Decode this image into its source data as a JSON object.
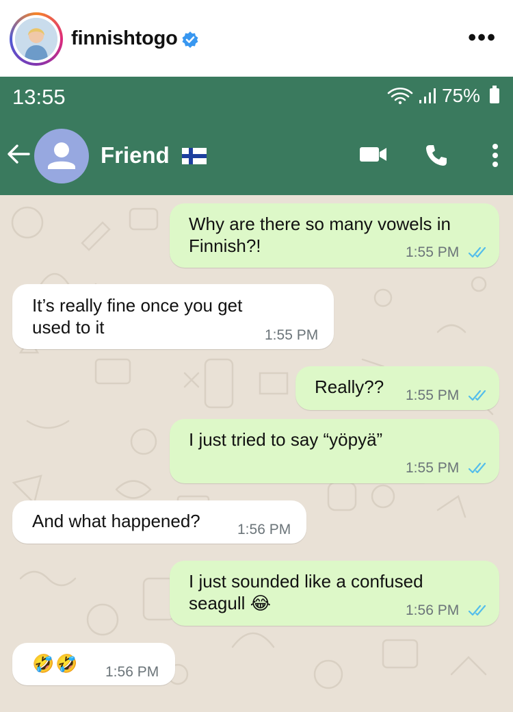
{
  "instagram": {
    "username": "finnishtogo",
    "more": "•••"
  },
  "status_bar": {
    "time": "13:55",
    "battery": "75%"
  },
  "chat_header": {
    "contact_name": "Friend"
  },
  "messages": [
    {
      "direction": "outgoing",
      "text": "Why are there so many vowels in\nFinnish?!",
      "time": "1:55 PM",
      "read": true
    },
    {
      "direction": "incoming",
      "text": "It’s really fine once you get\nused to it",
      "time": "1:55 PM"
    },
    {
      "direction": "outgoing",
      "text": "Really??",
      "time": "1:55 PM",
      "read": true
    },
    {
      "direction": "outgoing",
      "text": "I just tried to say “yöpyä”",
      "time": "1:55 PM",
      "read": true
    },
    {
      "direction": "incoming",
      "text": "And what happened?",
      "time": "1:56 PM"
    },
    {
      "direction": "outgoing",
      "text": "I just sounded like a confused\nseagull 😂",
      "time": "1:56 PM",
      "read": true
    },
    {
      "direction": "incoming",
      "text": "🤣🤣",
      "time": "1:56 PM"
    }
  ],
  "colors": {
    "header_green": "#3a7a5e",
    "outgoing_bubble": "#ddf8c8",
    "incoming_bubble": "#ffffff",
    "read_ticks": "#53bdeb",
    "chat_background": "#e9e1d6"
  }
}
